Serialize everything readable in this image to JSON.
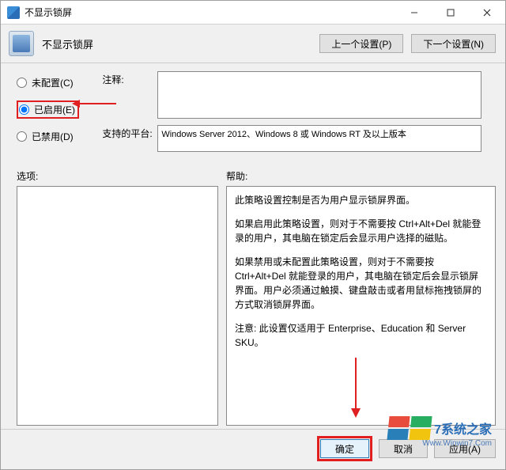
{
  "titlebar": {
    "title": "不显示锁屏"
  },
  "header": {
    "title": "不显示锁屏"
  },
  "nav": {
    "prev": "上一个设置(P)",
    "next": "下一个设置(N)"
  },
  "radios": {
    "not_configured": "未配置(C)",
    "enabled": "已启用(E)",
    "disabled": "已禁用(D)",
    "selected": "enabled"
  },
  "fields": {
    "comment_label": "注释:",
    "comment_value": "",
    "platform_label": "支持的平台:",
    "platform_value": "Windows Server 2012、Windows 8 或 Windows RT 及以上版本"
  },
  "lower": {
    "options_label": "选项:",
    "help_label": "帮助:"
  },
  "help_paragraphs": [
    "此策略设置控制是否为用户显示锁屏界面。",
    "如果启用此策略设置，则对于不需要按 Ctrl+Alt+Del 就能登录的用户，其电脑在锁定后会显示用户选择的磁贴。",
    "如果禁用或未配置此策略设置，则对于不需要按 Ctrl+Alt+Del 就能登录的用户，其电脑在锁定后会显示锁屏界面。用户必须通过触摸、键盘敲击或者用鼠标拖拽锁屏的方式取消锁屏界面。",
    "注意: 此设置仅适用于 Enterprise、Education 和 Server SKU。"
  ],
  "footer": {
    "ok": "确定",
    "cancel": "取消",
    "apply": "应用(A)"
  },
  "watermark": {
    "brand": "7系统之家",
    "url": "Www.Winwin7.Com"
  }
}
